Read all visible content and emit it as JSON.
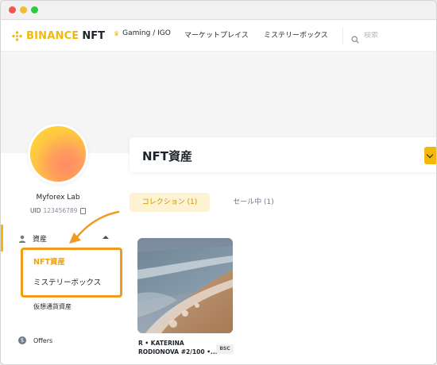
{
  "header": {
    "brand": "BINANCE",
    "brand_suffix": "NFT",
    "nav_items": [
      {
        "label": "Gaming / IGO"
      },
      {
        "label": "マーケットプレイス"
      },
      {
        "label": "ミステリーボックス"
      }
    ],
    "search_placeholder": "検索"
  },
  "profile": {
    "username": "Myforex Lab",
    "uid_label": "UID",
    "uid_value": "123456789"
  },
  "sidebar": {
    "assets_label": "資産",
    "sub_items": [
      {
        "label": "NFT資産"
      },
      {
        "label": "ミステリーボックス"
      },
      {
        "label": "仮想通貨資産"
      }
    ],
    "offers_label": "Offers",
    "offers_icon_glyph": "$"
  },
  "main": {
    "title": "NFT資産",
    "tabs": [
      {
        "label": "コレクション (1)"
      },
      {
        "label": "セール中 (1)"
      }
    ],
    "cards": [
      {
        "name": "R • KATERINA RODIONOVA #2/100 •...",
        "chain": "BSC"
      }
    ]
  },
  "colors": {
    "brand": "#f0b90b",
    "highlight": "#f29a1c",
    "active_text": "#f0a30b",
    "tab_active_bg": "#fdf3d2"
  }
}
